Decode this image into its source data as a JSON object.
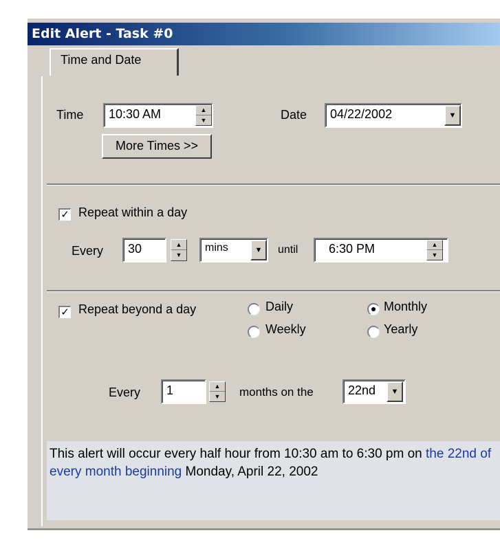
{
  "window": {
    "title": "Edit Alert - Task #0"
  },
  "tabs": [
    {
      "label": "Time and Date"
    }
  ],
  "time_section": {
    "time_label": "Time",
    "time_value": "10:30 AM",
    "date_label": "Date",
    "date_value": "04/22/2002",
    "more_times_button": "More Times >>"
  },
  "repeat_within_day": {
    "checked": true,
    "label": "Repeat within a day",
    "every_label": "Every",
    "interval_value": "30",
    "unit_value": "mins",
    "until_label": "until",
    "until_value": "6:30 PM"
  },
  "repeat_beyond_day": {
    "checked": true,
    "label": "Repeat beyond a day",
    "options": [
      {
        "label": "Daily",
        "selected": false
      },
      {
        "label": "Monthly",
        "selected": true
      },
      {
        "label": "Weekly",
        "selected": false
      },
      {
        "label": "Yearly",
        "selected": false
      }
    ],
    "every_label": "Every",
    "interval_value": "1",
    "months_label": "months on the",
    "day_value": "22nd"
  },
  "summary": {
    "part1": "This alert will occur every half hour from 10:30 am to 6:30 pm on ",
    "highlight": "the 22nd of every month beginning",
    "part2": " Monday, April 22, 2002"
  },
  "colors": {
    "face": "#d4d0c8",
    "title_start": "#0a246a",
    "title_end": "#a6caf0",
    "summary_bg": "#dfe3e8",
    "highlight_text": "#1d3a9e"
  }
}
